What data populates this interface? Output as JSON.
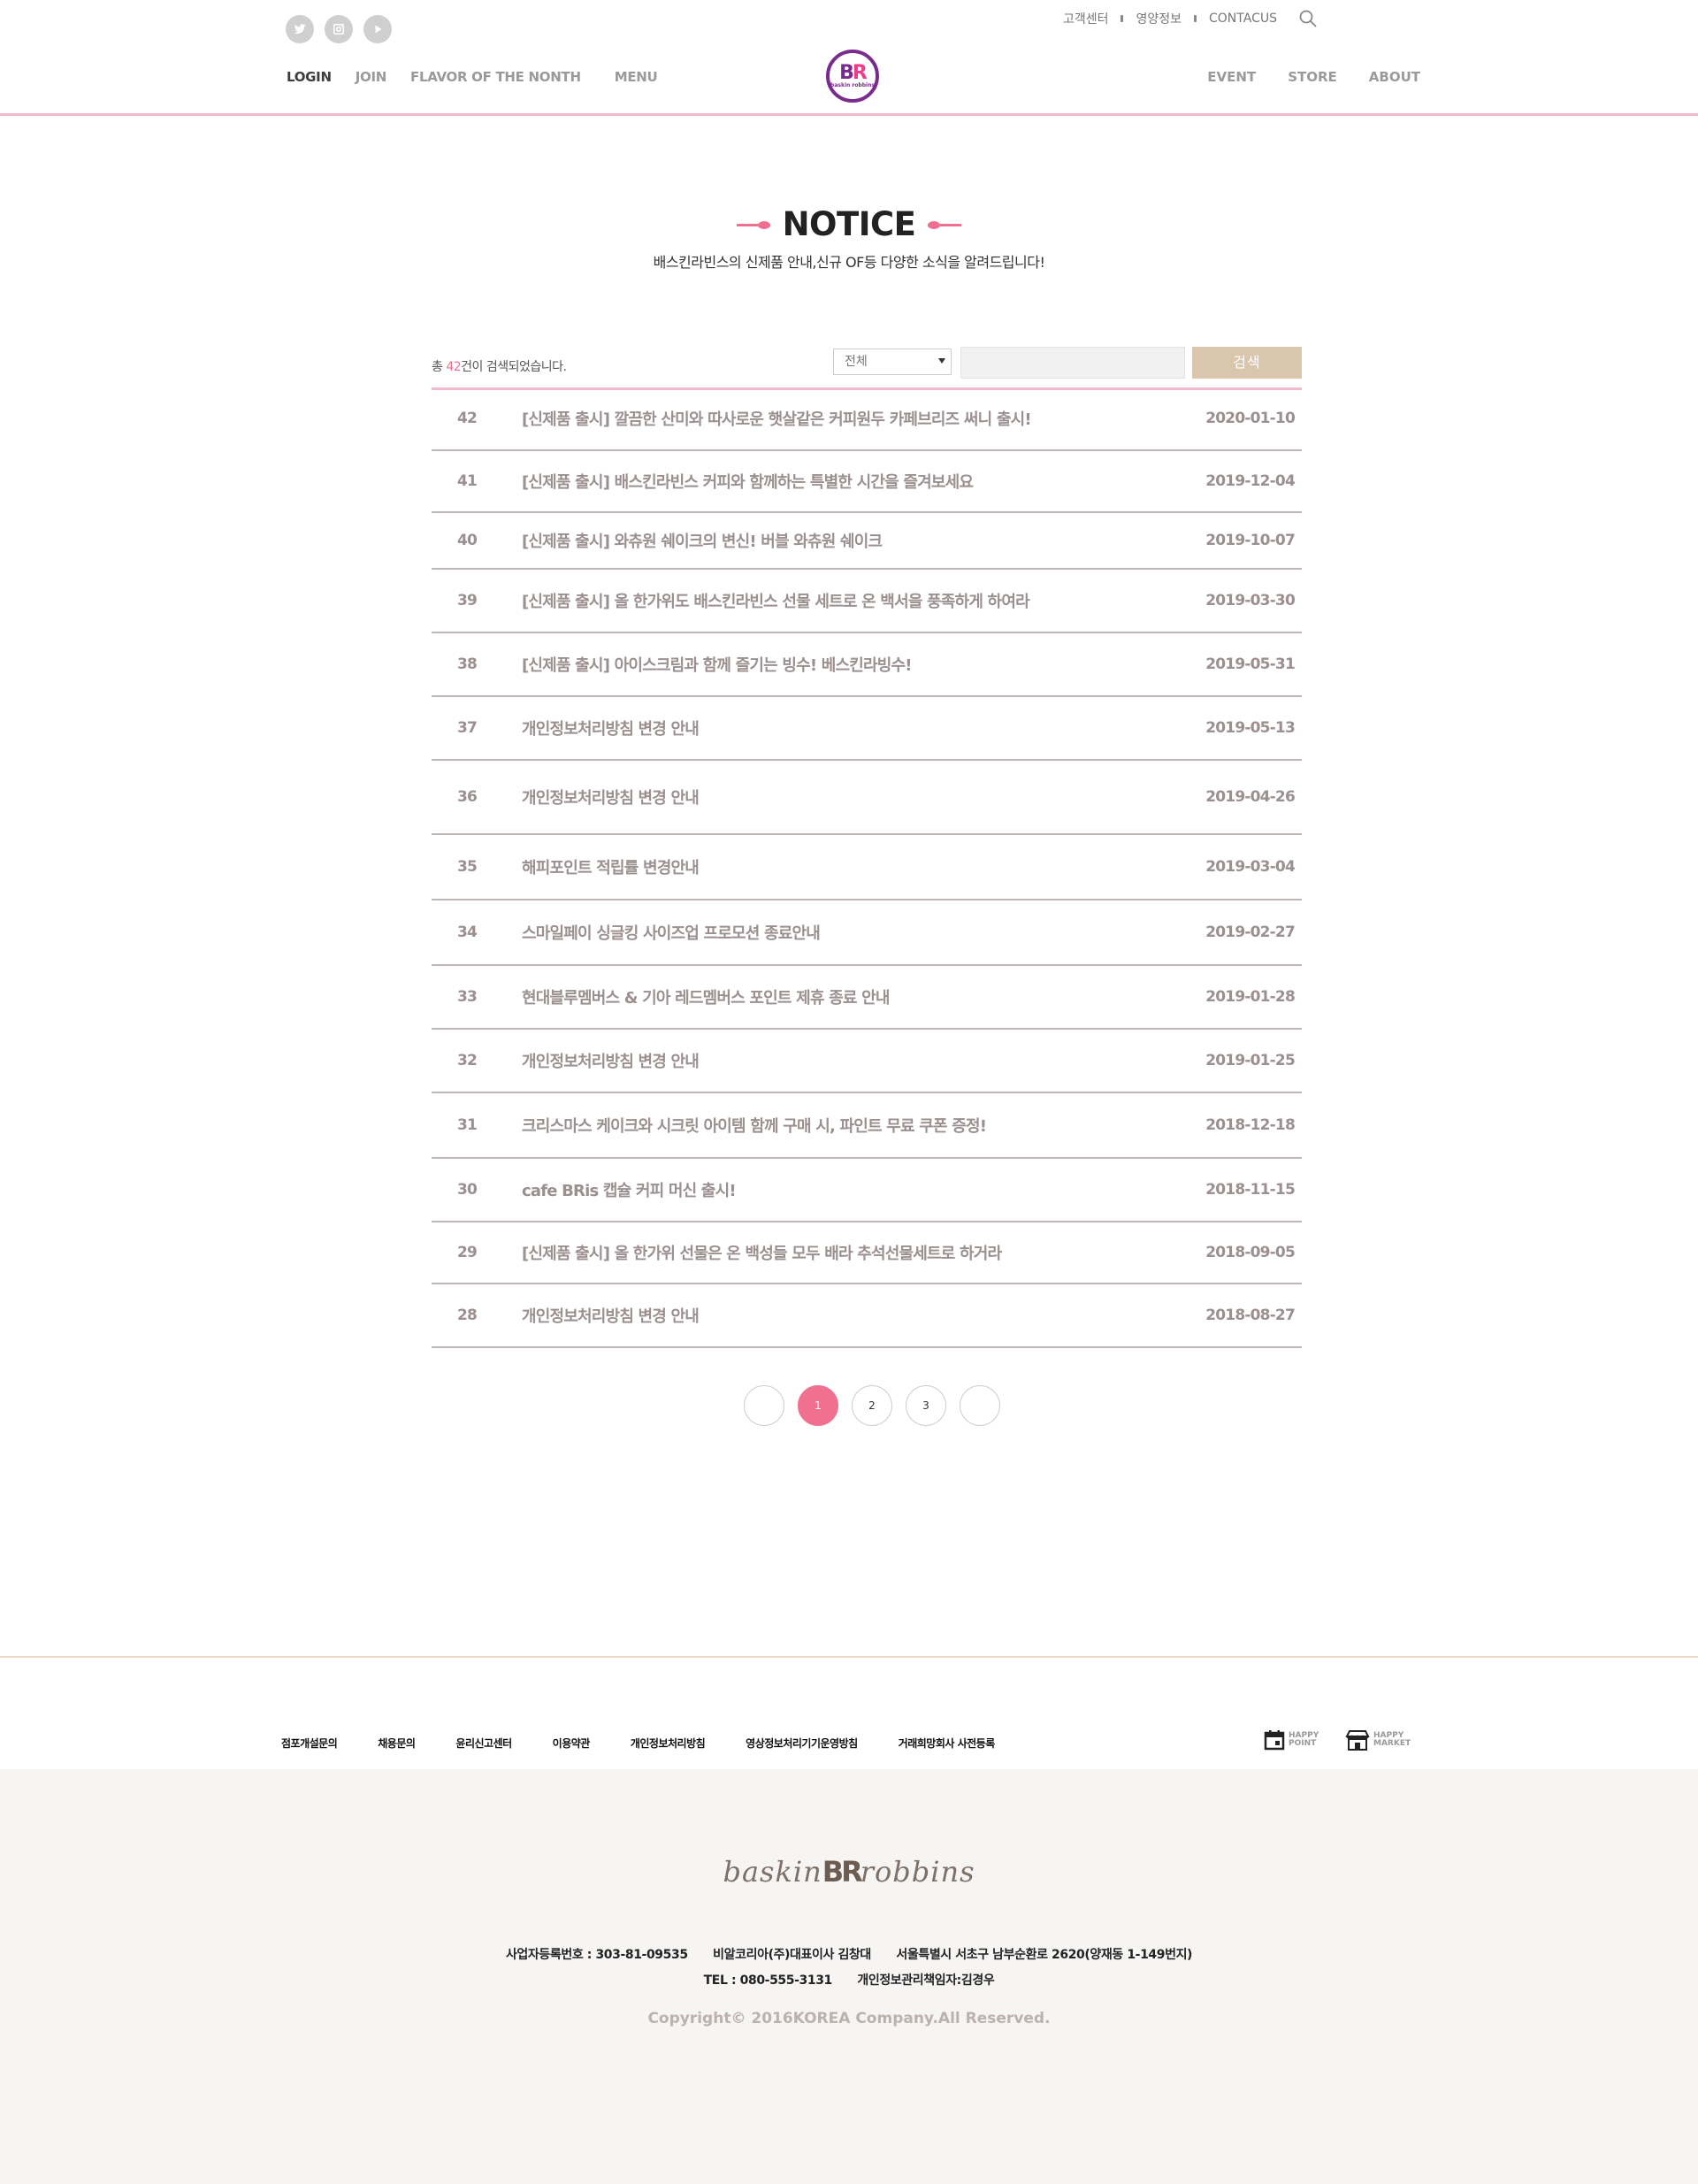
{
  "header": {
    "util_links": [
      "고객센터",
      "영양정보",
      "CONTACUS"
    ],
    "gnb_left": [
      "LOGIN",
      "JOIN",
      "FLAVOR OF THE NONTH",
      "MENU"
    ],
    "gnb_right": [
      "EVENT",
      "STORE",
      "ABOUT"
    ],
    "logo_text": "BR",
    "logo_sub": "baskin robbins"
  },
  "notice": {
    "title": "NOTICE",
    "subtitle": "배스킨라빈스의 신제품 안내,신규 OF등 다양한 소식을 알려드립니다!"
  },
  "board": {
    "total_prefix": "총 ",
    "total_count": "42",
    "total_suffix": "건이 검색되었습니다.",
    "filter_selected": "전체",
    "search_button": "검색",
    "rows": [
      {
        "no": "42",
        "title": "[신제품 출시] 깔끔한 산미와 따사로운 햇살같은 커피원두 카페브리즈 써니 출시!",
        "date": "2020-01-10"
      },
      {
        "no": "41",
        "title": "[신제품 출시] 배스킨라빈스 커피와 함께하는 특별한 시간을 즐겨보세요",
        "date": "2019-12-04"
      },
      {
        "no": "40",
        "title": "[신제품  출시] 와츄원 쉐이크의 변신! 버블 와츄원 쉐이크",
        "date": "2019-10-07"
      },
      {
        "no": "39",
        "title": "[신제품 출시] 올 한가위도 배스킨라빈스 선물 세트로 온 백서을 풍족하게 하여라",
        "date": "2019-03-30"
      },
      {
        "no": "38",
        "title": "[신제품 출시] 아이스크림과 함께 즐기는 빙수! 베스킨라빙수!",
        "date": "2019-05-31"
      },
      {
        "no": "37",
        "title": "개인정보처리방침 변경 안내",
        "date": "2019-05-13"
      },
      {
        "no": "36",
        "title": "개인정보처리방침 변경 안내",
        "date": "2019-04-26"
      },
      {
        "no": "35",
        "title": "해피포인트 적립률 변경안내",
        "date": "2019-03-04"
      },
      {
        "no": "34",
        "title": "스마일페이 싱글킹 사이즈업 프로모션 종료안내",
        "date": "2019-02-27"
      },
      {
        "no": "33",
        "title": "현대블루멤버스 & 기아 레드멤버스 포인트 제휴 종료 안내",
        "date": "2019-01-28"
      },
      {
        "no": "32",
        "title": "개인정보처리방침 변경 안내",
        "date": "2019-01-25"
      },
      {
        "no": "31",
        "title": "크리스마스 케이크와 시크릿 아이템 함께 구매 시, 파인트 무료 쿠폰 증정!",
        "date": "2018-12-18"
      },
      {
        "no": "30",
        "title": "cafe BRis 캡슐 커피 머신 출시!",
        "date": "2018-11-15"
      },
      {
        "no": "29",
        "title": "[신제품 출시] 올 한가위 선물은 온 백성들 모두 배라 추석선물세트로 하거라",
        "date": "2018-09-05"
      },
      {
        "no": "28",
        "title": "개인정보처리방침 변경 안내",
        "date": "2018-08-27"
      }
    ]
  },
  "pagination": {
    "pages": [
      "1",
      "2",
      "3"
    ],
    "current": "1"
  },
  "footer": {
    "menu": [
      "점포개설문의",
      "채용문의",
      "윤리신고센터",
      "이용약관",
      "개인정보처리방침",
      "영상정보처리기기운영방침",
      "거래희망회사 사전등록"
    ],
    "happy_point": [
      "HAPPY",
      "POINT"
    ],
    "happy_market": [
      "HAPPY",
      "MARKET"
    ],
    "logo_left": "baskin",
    "logo_mid": "BR",
    "logo_right": "robbins",
    "info_line1": [
      "사업자등록번호 : 303-81-09535",
      "비알코리아(주)대표이사 김창대",
      "서울특별시 서초구 남부순환로 2620(양재동 1-149번지)"
    ],
    "info_line2": [
      "TEL : 080-555-3131",
      "개인정보관리책임자:김경우"
    ],
    "copyright": "Copyright© 2016KOREA Company.All Reserved."
  },
  "colors": {
    "accent_pink": "#f07090",
    "search_button": "#d9c6ad",
    "row_text": "#9b8f8f"
  }
}
